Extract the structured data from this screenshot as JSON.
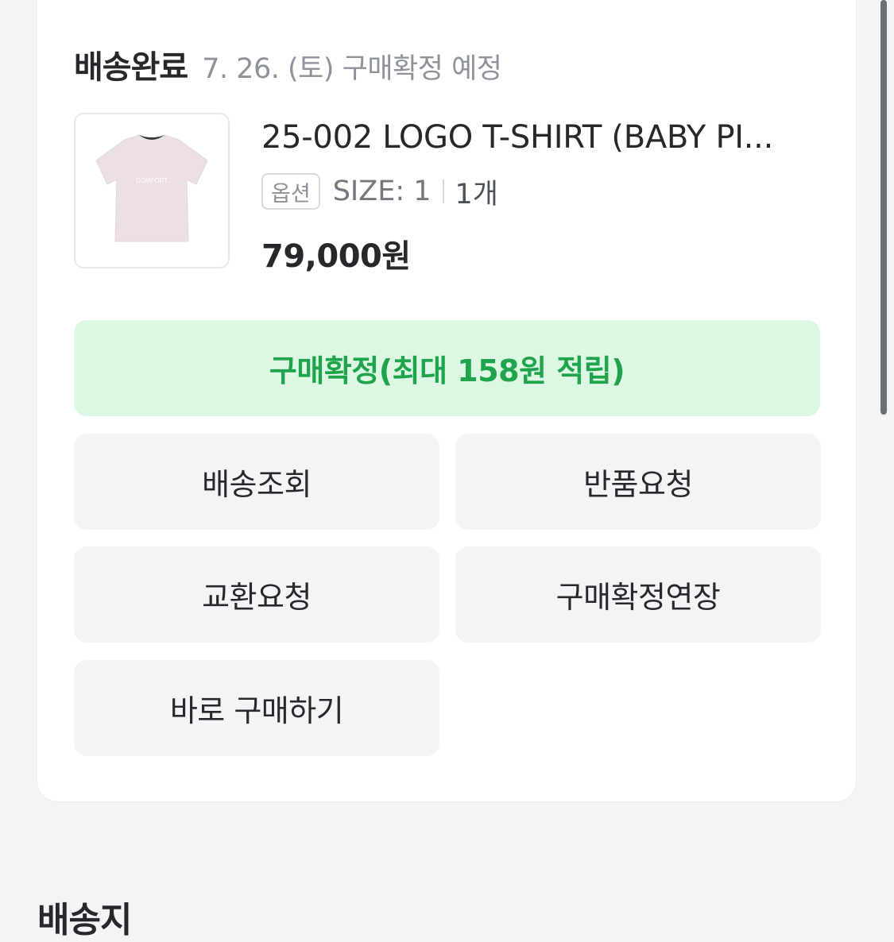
{
  "order": {
    "status": "배송완료",
    "status_note": "7. 26. (토) 구매확정 예정"
  },
  "product": {
    "image_icon": "tshirt-product-photo",
    "image_logo_text": "COMFORT",
    "name": "25-002 LOGO T-SHIRT (BABY PI...",
    "option_badge": "옵션",
    "option": "SIZE: 1",
    "quantity": "1개",
    "price": "79,000원"
  },
  "actions": {
    "confirm_purchase": "구매확정(최대 158원 적립)",
    "track_delivery": "배송조회",
    "request_return": "반품요청",
    "request_exchange": "교환요청",
    "extend_confirmation": "구매확정연장",
    "buy_again": "바로 구매하기"
  },
  "next_section": {
    "title": "배송지"
  },
  "colors": {
    "primary_text": "#1fa34b",
    "primary_bg": "#dcf8e3",
    "secondary_bg": "#f3f4f6",
    "page_bg": "#f3f4f6"
  }
}
